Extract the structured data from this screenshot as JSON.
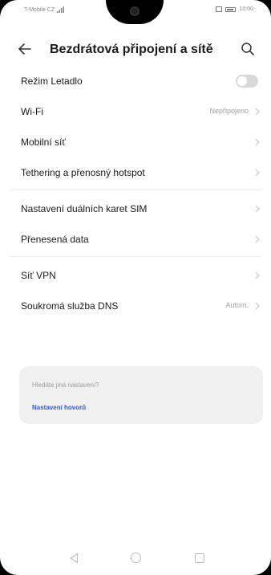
{
  "status_bar": {
    "carrier": "T-Mobile CZ",
    "time": "10:00"
  },
  "header": {
    "title": "Bezdrátová připojení a sítě"
  },
  "settings": {
    "airplane_mode": {
      "label": "Režim Letadlo",
      "enabled": false
    },
    "wifi": {
      "label": "Wi-Fi",
      "value": "Nepřipojeno"
    },
    "mobile_network": {
      "label": "Mobilní síť"
    },
    "tethering": {
      "label": "Tethering a přenosný hotspot"
    },
    "dual_sim": {
      "label": "Nastavení duálních karet SIM"
    },
    "data_usage": {
      "label": "Přenesená data"
    },
    "vpn": {
      "label": "Síť VPN"
    },
    "private_dns": {
      "label": "Soukromá služba DNS",
      "value": "Autom."
    }
  },
  "suggestion_card": {
    "hint": "Hledáte jiná nastavení?",
    "link": "Nastavení hovorů"
  },
  "colors": {
    "accent": "#2f5bd8",
    "toggle_off": "#d8d8d8",
    "card_bg": "#f0f0f0"
  },
  "icons": {
    "back": "arrow-left-icon",
    "search": "search-icon",
    "chevron": "chevron-right-icon",
    "nav_back": "triangle-back-icon",
    "nav_home": "circle-home-icon",
    "nav_recent": "square-recents-icon"
  }
}
